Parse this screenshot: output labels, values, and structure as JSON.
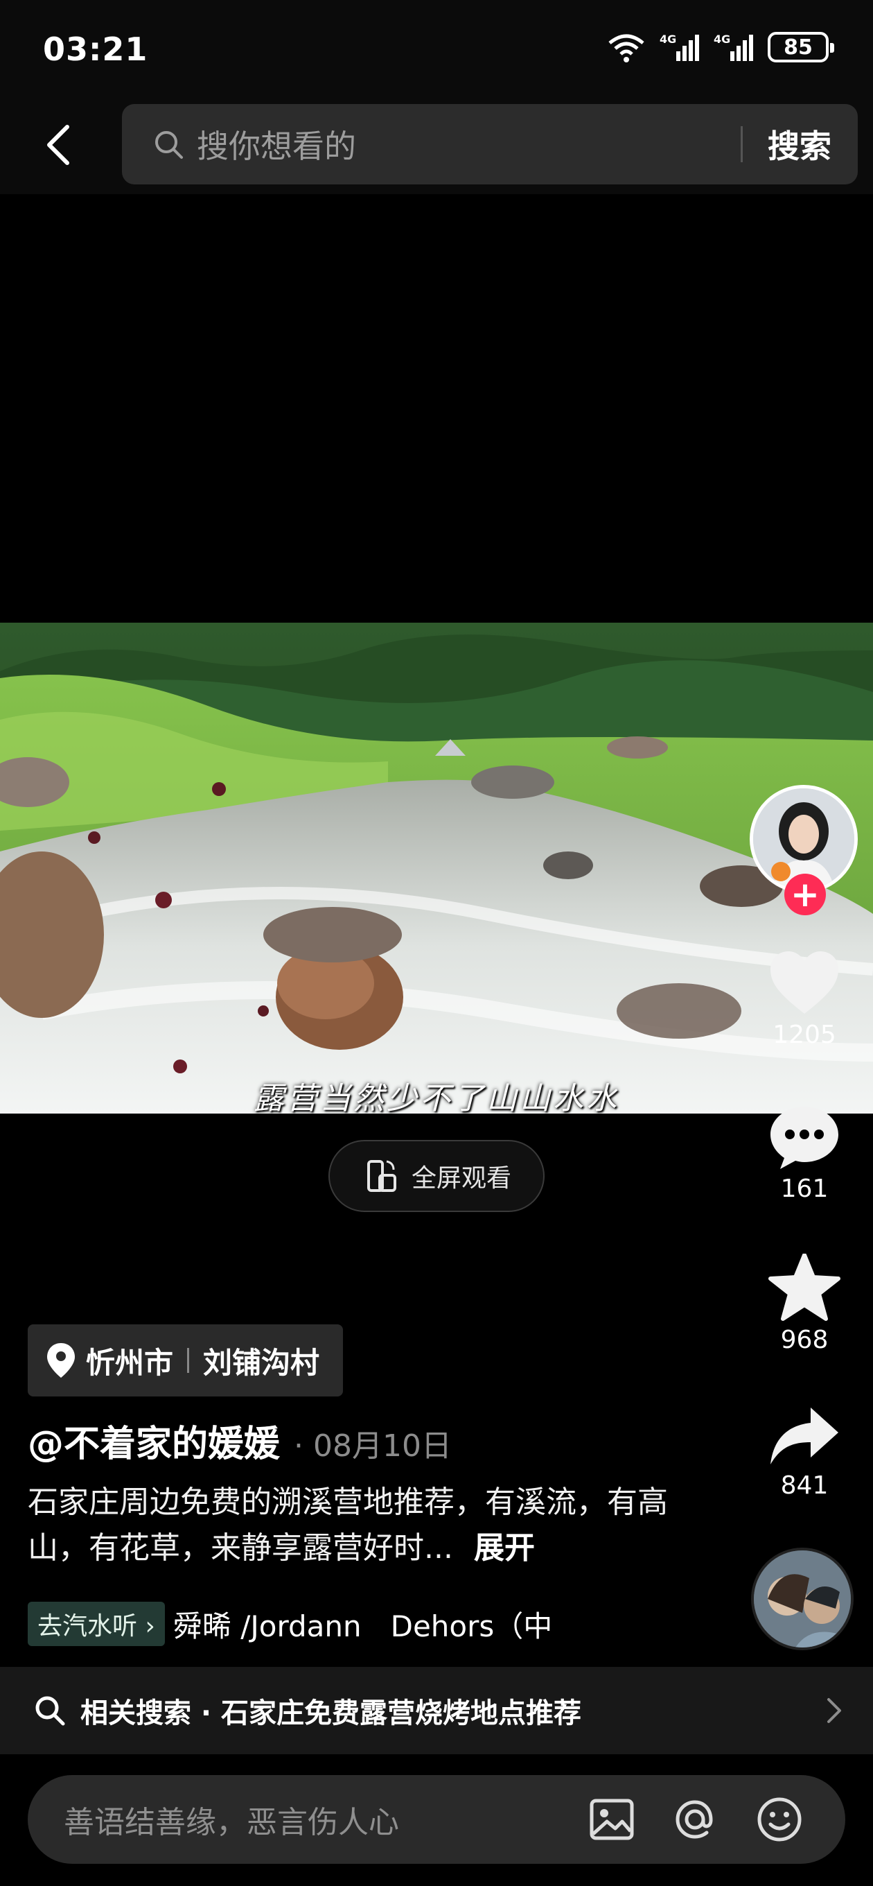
{
  "status": {
    "time": "03:21",
    "battery": "85",
    "signal1": "4G",
    "signal2": "4G",
    "wifi": "6"
  },
  "search": {
    "placeholder": "搜你想看的",
    "button": "搜索"
  },
  "video": {
    "subtitle": "露营当然少不了山山水水",
    "fullscreen_label": "全屏观看"
  },
  "actions": {
    "likes": "1205",
    "comments": "161",
    "favorites": "968",
    "shares": "841",
    "follow": "+"
  },
  "post": {
    "city": "忻州市",
    "village": "刘铺沟村",
    "author": "@不着家的媛媛",
    "date": "· 08月10日",
    "caption": "石家庄周边免费的溯溪营地推荐，有溪流，有高山，有花草，来静享露营好时...",
    "expand": "展开",
    "music_chip": "去汽水听",
    "music_name": "舜晞 /Jordann　Dehors（中"
  },
  "related": {
    "text": "相关搜索 · 石家庄免费露营烧烤地点推荐"
  },
  "comment": {
    "placeholder": "善语结善缘，恶言伤人心"
  },
  "colors": {
    "accent": "#fe2c55",
    "background": "#000000",
    "chip": "#2a2a2a"
  }
}
